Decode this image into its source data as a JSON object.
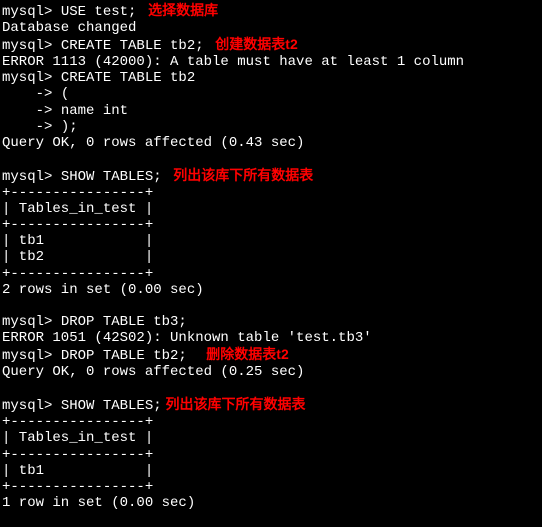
{
  "lines": [
    {
      "prompt": "mysql> ",
      "cmd": "USE test;",
      "note": "   选择数据库"
    },
    {
      "text": "Database changed"
    },
    {
      "prompt": "mysql> ",
      "cmd": "CREATE TABLE tb2;",
      "note": "   创建数据表t2"
    },
    {
      "text": "ERROR 1113 (42000): A table must have at least 1 column"
    },
    {
      "prompt": "mysql> ",
      "cmd": "CREATE TABLE tb2"
    },
    {
      "prompt": "    -> ",
      "cmd": "("
    },
    {
      "prompt": "    -> ",
      "cmd": "name int"
    },
    {
      "prompt": "    -> ",
      "cmd": ");"
    },
    {
      "text": "Query OK, 0 rows affected (0.43 sec)"
    },
    {
      "text": " "
    },
    {
      "prompt": "mysql> ",
      "cmd": "SHOW TABLES;",
      "note": "   列出该库下所有数据表"
    },
    {
      "text": "+----------------+"
    },
    {
      "text": "| Tables_in_test |"
    },
    {
      "text": "+----------------+"
    },
    {
      "text": "| tb1            |"
    },
    {
      "text": "| tb2            |"
    },
    {
      "text": "+----------------+"
    },
    {
      "text": "2 rows in set (0.00 sec)"
    },
    {
      "text": " "
    },
    {
      "prompt": "mysql> ",
      "cmd": "DROP TABLE tb3;"
    },
    {
      "text": "ERROR 1051 (42S02): Unknown table 'test.tb3'"
    },
    {
      "prompt": "mysql> ",
      "cmd": "DROP TABLE tb2;",
      "note": "     删除数据表t2"
    },
    {
      "text": "Query OK, 0 rows affected (0.25 sec)"
    },
    {
      "text": " "
    },
    {
      "prompt": "mysql> ",
      "cmd": "SHOW TABLES;",
      "note": " 列出该库下所有数据表"
    },
    {
      "text": "+----------------+"
    },
    {
      "text": "| Tables_in_test |"
    },
    {
      "text": "+----------------+"
    },
    {
      "text": "| tb1            |"
    },
    {
      "text": "+----------------+"
    },
    {
      "text": "1 row in set (0.00 sec)"
    },
    {
      "text": " "
    }
  ]
}
